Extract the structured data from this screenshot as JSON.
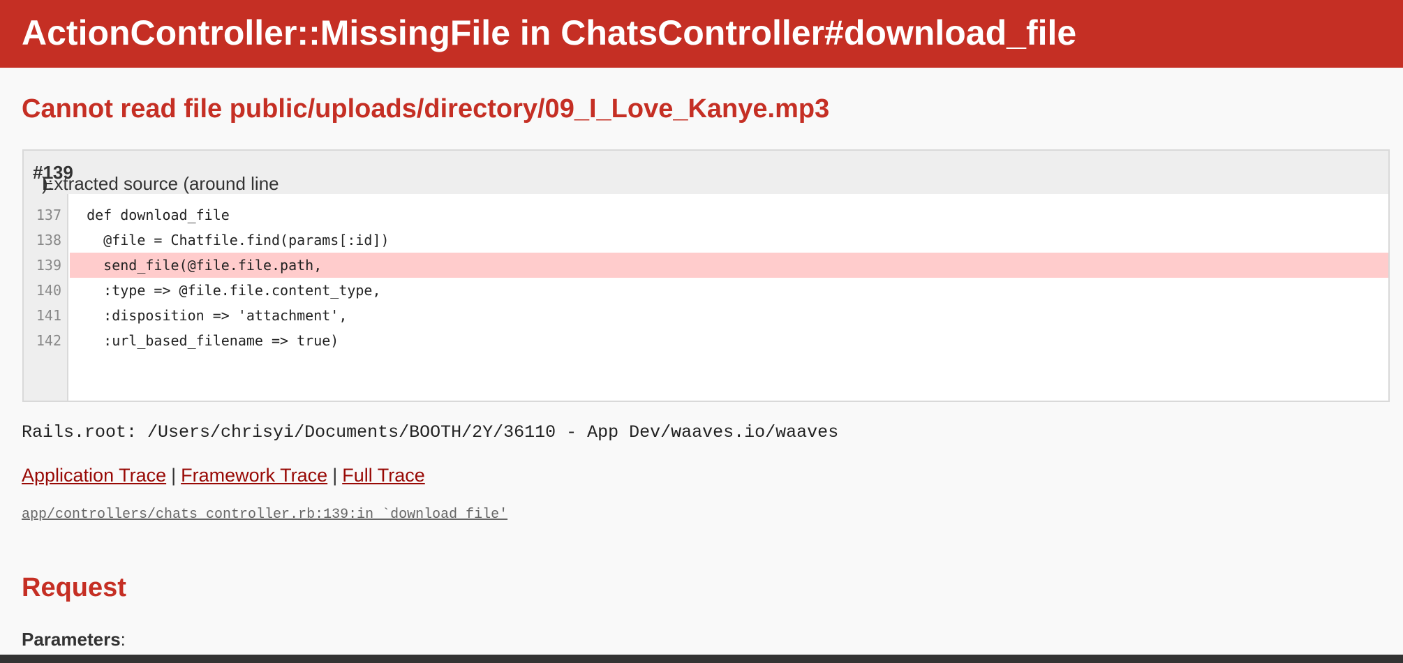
{
  "header": {
    "title": "ActionController::MissingFile in ChatsController#download_file"
  },
  "error": {
    "message": "Cannot read file public/uploads/directory/09_I_Love_Kanye.mp3"
  },
  "source": {
    "heading_prefix": "Extracted source (around line ",
    "heading_line": "#139",
    "heading_suffix": "):",
    "lines": [
      {
        "no": "137",
        "code": "  def download_file"
      },
      {
        "no": "138",
        "code": "    @file = Chatfile.find(params[:id])"
      },
      {
        "no": "139",
        "code": "    send_file(@file.file.path,"
      },
      {
        "no": "140",
        "code": "    :type => @file.file.content_type,"
      },
      {
        "no": "141",
        "code": "    :disposition => 'attachment',"
      },
      {
        "no": "142",
        "code": "    :url_based_filename => true)"
      }
    ],
    "highlighted_line": "139"
  },
  "rails_root": "Rails.root: /Users/chrisyi/Documents/BOOTH/2Y/36110 - App Dev/waaves.io/waaves",
  "trace": {
    "links": [
      "Application Trace",
      "Framework Trace",
      "Full Trace"
    ],
    "separator": "|",
    "entry": "app/controllers/chats_controller.rb:139:in `download_file'"
  },
  "request": {
    "title": "Request",
    "params_label": "Parameters",
    "params_colon": ":"
  },
  "colors": {
    "header_bg": "#c52f24",
    "link": "#980905",
    "highlight": "#ffcccc"
  }
}
